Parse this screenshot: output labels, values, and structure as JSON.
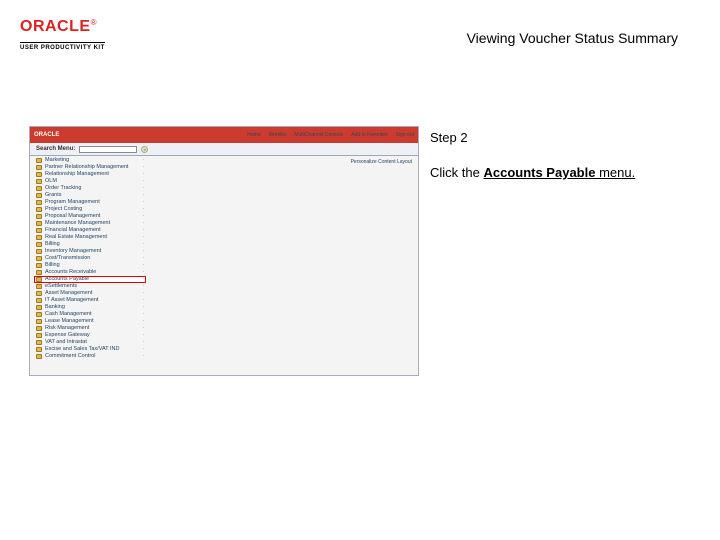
{
  "brand": {
    "name": "ORACLE",
    "tm": "®",
    "subtitle": "USER PRODUCTIVITY KIT"
  },
  "doc": {
    "title": "Viewing Voucher Status Summary"
  },
  "step": {
    "label": "Step 2",
    "pre": "Click the ",
    "bold": "Accounts Payable",
    "post": " menu."
  },
  "inner": {
    "appLogo": "ORACLE",
    "toolbar": [
      "Home",
      "Worklist",
      "MultiChannel Console",
      "Add to Favorites",
      "Sign out"
    ],
    "searchLabel": "Search Menu:",
    "goGlyph": ">",
    "rightHint": "Personalize Content  Layout"
  },
  "nav": [
    {
      "label": "Marketing",
      "hl": false
    },
    {
      "label": "Partner Relationship Management",
      "hl": false
    },
    {
      "label": "Relationship Management",
      "hl": false
    },
    {
      "label": "OLM",
      "hl": false
    },
    {
      "label": "Order Tracking",
      "hl": false
    },
    {
      "label": "Grants",
      "hl": false
    },
    {
      "label": "Program Management",
      "hl": false
    },
    {
      "label": "Project Costing",
      "hl": false
    },
    {
      "label": "Proposal Management",
      "hl": false
    },
    {
      "label": "Maintenance Management",
      "hl": false
    },
    {
      "label": "Financial Management",
      "hl": false
    },
    {
      "label": "Real Estate Management",
      "hl": false
    },
    {
      "label": "Billing",
      "hl": false
    },
    {
      "label": "Inventory Management",
      "hl": false
    },
    {
      "label": "Cost/Transmission",
      "hl": false
    },
    {
      "label": "Billing",
      "hl": false
    },
    {
      "label": "Accounts Receivable",
      "hl": false
    },
    {
      "label": "Accounts Payable",
      "hl": true
    },
    {
      "label": "eSettlements",
      "hl": false
    },
    {
      "label": "Asset Management",
      "hl": false
    },
    {
      "label": "IT Asset Management",
      "hl": false
    },
    {
      "label": "Banking",
      "hl": false
    },
    {
      "label": "Cash Management",
      "hl": false
    },
    {
      "label": "Lease Management",
      "hl": false
    },
    {
      "label": "Risk Management",
      "hl": false
    },
    {
      "label": "Expense Gateway",
      "hl": false
    },
    {
      "label": "VAT and Intrastat",
      "hl": false
    },
    {
      "label": "Excise and Sales Tax/VAT IND",
      "hl": false
    },
    {
      "label": "Commitment Control",
      "hl": false
    }
  ]
}
